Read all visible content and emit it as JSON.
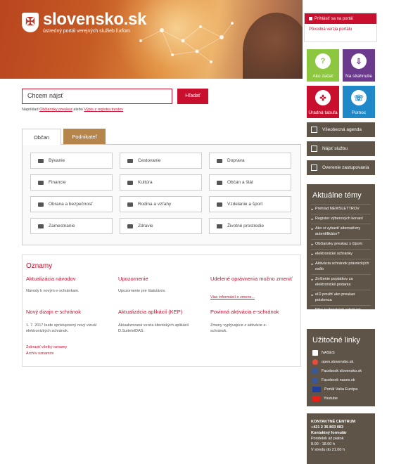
{
  "header": {
    "logo_title": "slovensko.sk",
    "logo_subtitle": "ústredný portál verejných služieb ľuďom",
    "crest_glyph": "✠"
  },
  "auth": {
    "login_label": "Prihlásiť sa na portál",
    "original_portal_label": "Pôvodná verzia portálu"
  },
  "tiles": [
    {
      "label": "Ako začať",
      "glyph": "?",
      "color": "#8dc63f",
      "icon": "question-icon"
    },
    {
      "label": "Na stiahnutie",
      "glyph": "⇩",
      "color": "#6b3a8c",
      "icon": "download-icon"
    },
    {
      "label": "Úradná tabuľa",
      "glyph": "✜",
      "color": "#c8102e",
      "icon": "noticeboard-icon"
    },
    {
      "label": "Pomoc",
      "glyph": "☏",
      "color": "#1e88c8",
      "icon": "phone-icon"
    }
  ],
  "side_buttons": [
    "Všeobecná agenda",
    "Nájsť službu",
    "Overenie zastupovania"
  ],
  "topics": {
    "title": "Aktuálne témy",
    "items": [
      "Prehľad NEWSLETTROV",
      "Register výberových konaní",
      "Ako si vybaviť alternatívny autentifikátor?",
      "Občiansky preukaz s čipom",
      "elektronické schránky",
      "Aktivácia schránok právnických osôb",
      "Zníženie poplatkov za elektronické podania",
      "eID použiť ako preukaz poistenca",
      "Plán technických odstávok"
    ]
  },
  "useful_links": {
    "title": "Užitočné linky",
    "items": [
      {
        "label": "NASES",
        "icon": "nases-icon",
        "color": "#ffffff"
      },
      {
        "label": "open.slovensko.sk",
        "icon": "open-slovensko-icon",
        "color": "#e74c3c"
      },
      {
        "label": "Facebook slovensko.sk",
        "icon": "facebook-icon",
        "color": "#3b5998"
      },
      {
        "label": "Facebook nases.sk",
        "icon": "facebook-icon",
        "color": "#3b5998"
      },
      {
        "label": "Portál Vaša Európa",
        "icon": "eu-flag-icon",
        "color": "#1f3f9a"
      },
      {
        "label": "Youtube",
        "icon": "youtube-icon",
        "color": "#e62117"
      }
    ]
  },
  "contact": {
    "title": "KONTAKTNÉ CENTRUM",
    "phone": "+421 2 35 803 083",
    "form": "Kontaktný formulár",
    "days": "Pondelok až piatok",
    "hours": "8.00 - 18.00 h",
    "wednesday": "V stredu do 21.00 h"
  },
  "search": {
    "value": "Chcem nájsť",
    "button_label": "Hľadať",
    "hint_prefix": "Napríklad",
    "hint_link1": "Občiansky preukaz",
    "hint_middle": "alebo",
    "hint_link2": "Výpis z registra trestov"
  },
  "tabs": [
    "Občan",
    "Podnikateľ"
  ],
  "categories": [
    "Bývanie",
    "Cestovanie",
    "Doprava",
    "Financie",
    "Kultúra",
    "Občan a štát",
    "Obrana a bezpečnosť",
    "Rodina a vzťahy",
    "Vzdelanie a šport",
    "Zamestnanie",
    "Zdravie",
    "Životné prostredie"
  ],
  "news": {
    "title": "Oznamy",
    "items": [
      {
        "title": "Aktualizácia návodov",
        "text": "Návody k novým e-schránkam.",
        "link": ""
      },
      {
        "title": "Upozornenie",
        "text": "Upozornenie pre štatutárov.",
        "link": ""
      },
      {
        "title": "Udelené oprávnenia možno zmeniť",
        "text": "",
        "link": "Viac informácií o zmene..."
      },
      {
        "title": "Nový dizajn e-schránok",
        "text": "1. 7. 2017 bude sprístupnený nový vizuál elektronických schránok.",
        "link": ""
      },
      {
        "title": "Aktualizácia aplikácií (KEP)",
        "text": "Aktualizovaná verzia klientských aplikácií D.Suite/eIDAS.",
        "link": ""
      },
      {
        "title": "Povinná aktivácia e-schránok",
        "text": "Zmeny vyplývajúce z aktivácie e-schránok.",
        "link": ""
      }
    ],
    "all_label": "Zobraziť všetky oznamy",
    "archive_label": "Archív oznamov"
  },
  "colors": {
    "brand_red": "#c8102e",
    "panel_brown": "#5e5448",
    "tab_tan": "#b5854b"
  }
}
